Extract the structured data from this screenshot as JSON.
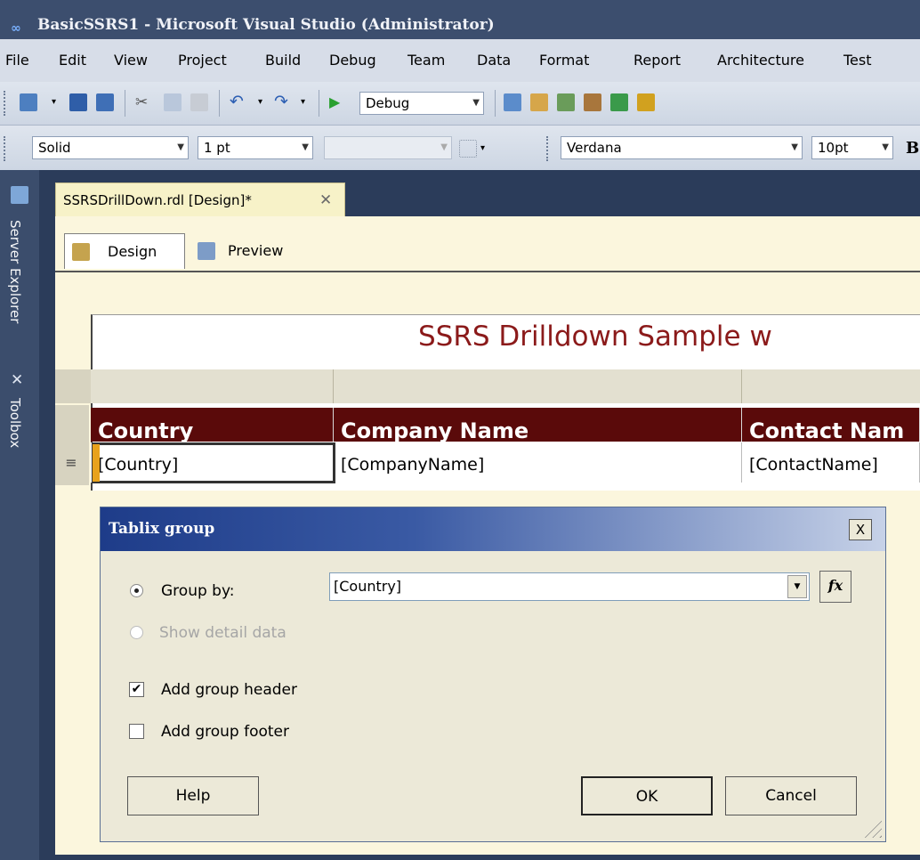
{
  "window": {
    "title": "BasicSSRS1 - Microsoft Visual Studio (Administrator)"
  },
  "menu": [
    "File",
    "Edit",
    "View",
    "Project",
    "Build",
    "Debug",
    "Team",
    "Data",
    "Format",
    "Report",
    "Architecture",
    "Test"
  ],
  "toolbar": {
    "config": "Debug",
    "border_style": "Solid",
    "border_width": "1 pt",
    "font": "Verdana",
    "font_size": "10pt",
    "bold": "B"
  },
  "sidebar": {
    "tabs": [
      "Server Explorer",
      "Toolbox"
    ]
  },
  "document": {
    "tab_label": "SSRSDrillDown.rdl [Design]*",
    "close": "✕",
    "subtabs": [
      "Design",
      "Preview"
    ]
  },
  "report": {
    "title": "SSRS Drilldown Sample w",
    "headers": [
      "Country",
      "Company Name",
      "Contact Nam"
    ],
    "fields": [
      "[Country]",
      "[CompanyName]",
      "[ContactName]"
    ],
    "group_indicator": "≡"
  },
  "dialog": {
    "title": "Tablix group",
    "close": "X",
    "group_by_label": "Group by:",
    "group_by_value": "[Country]",
    "fx_label": "fx",
    "show_detail_label": "Show detail data",
    "add_header_label": "Add group header",
    "add_header_checked": true,
    "add_footer_label": "Add group footer",
    "add_footer_checked": false,
    "help_label": "Help",
    "ok_label": "OK",
    "cancel_label": "Cancel"
  }
}
